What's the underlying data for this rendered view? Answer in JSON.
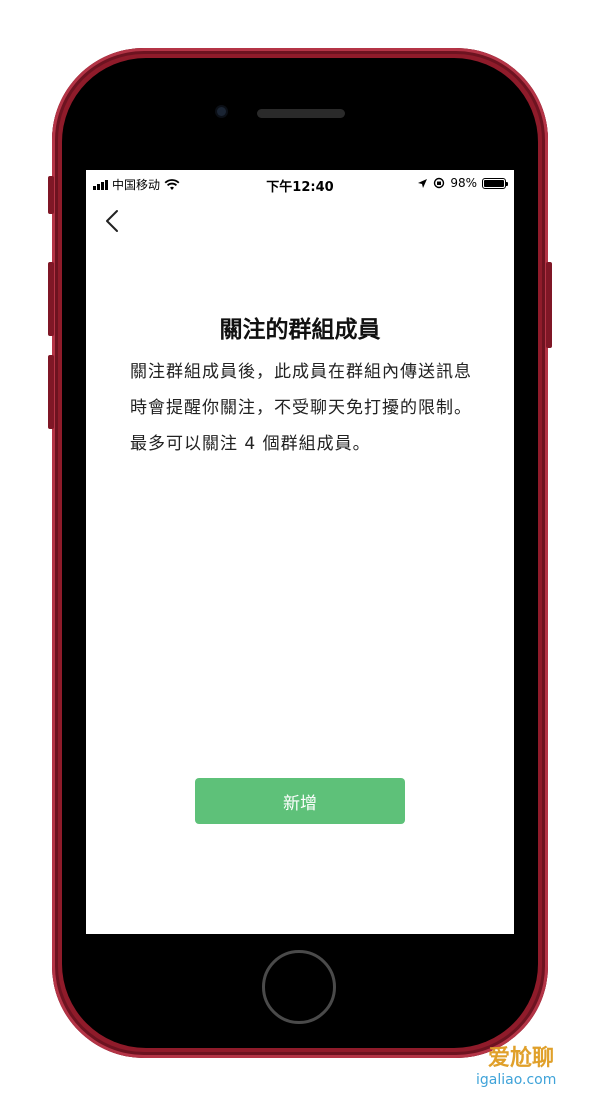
{
  "status_bar": {
    "carrier": "中国移动",
    "time": "下午12:40",
    "battery": "98%",
    "battery_level": 0.98
  },
  "nav": {
    "back_icon": "chevron-left-icon"
  },
  "content": {
    "title": "關注的群組成員",
    "description": "關注群組成員後，此成員在群組內傳送訊息時會提醒你關注，不受聊天免打擾的限制。最多可以關注 4 個群組成員。"
  },
  "actions": {
    "add_label": "新增"
  },
  "watermark": {
    "text": "爱尬聊",
    "url": "igaliao.com"
  },
  "colors": {
    "phone": "#8f1b2a",
    "button": "#5ec179"
  }
}
